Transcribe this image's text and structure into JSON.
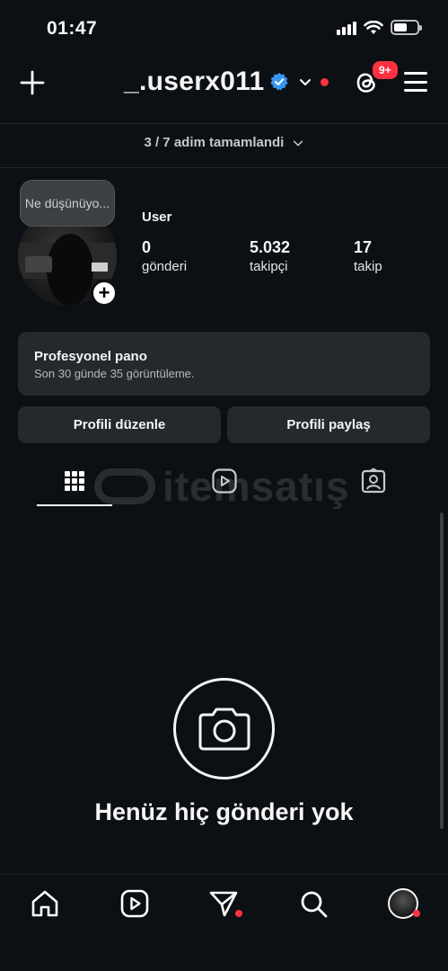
{
  "status_bar": {
    "time": "01:47"
  },
  "header": {
    "username": "_.userx011",
    "notification_badge": "9+"
  },
  "onboarding": {
    "progress": "3 / 7",
    "label": "adim tamamlandi"
  },
  "profile": {
    "note": "Ne düşünüyo...",
    "display_name": "User",
    "stats": [
      {
        "value": "0",
        "label": "gönderi"
      },
      {
        "value": "5.032",
        "label": "takipçi"
      },
      {
        "value": "17",
        "label": "takip"
      }
    ]
  },
  "pro_panel": {
    "title": "Profesyonel pano",
    "subtitle": "Son 30 günde 35 görüntüleme."
  },
  "actions": {
    "edit": "Profili düzenle",
    "share": "Profili paylaş"
  },
  "watermark": {
    "text": "itemsatış"
  },
  "empty_state": {
    "text": "Henüz hiç gönderi yok"
  },
  "colors": {
    "background": "#0c1014",
    "accent": "#ff3040",
    "verified": "#3797f0",
    "button": "#25292e"
  }
}
